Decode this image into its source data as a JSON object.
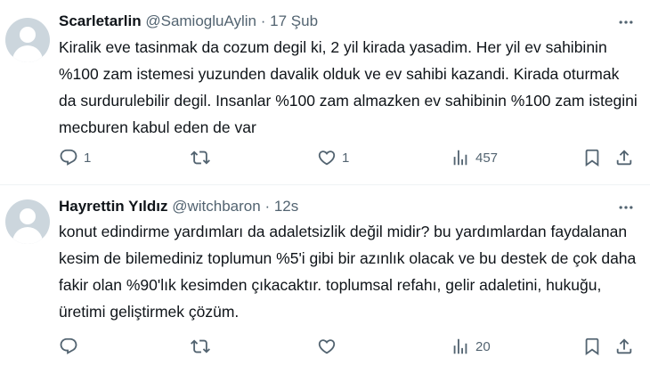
{
  "tweets": [
    {
      "author_name": "Scarletarlin",
      "handle": "@SamiogluAylin",
      "separator": "·",
      "time": "17 Şub",
      "text": "Kiralik eve tasinmak da cozum degil ki, 2 yil kirada yasadim. Her yil ev sahibinin %100 zam istemesi yuzunden davalik olduk ve ev sahibi kazandi. Kirada oturmak da surdurulebilir degil. Insanlar %100 zam almazken ev sahibinin %100 zam istegini mecburen kabul eden de var",
      "replies": "1",
      "retweets": "",
      "likes": "1",
      "views": "457"
    },
    {
      "author_name": "Hayrettin Yıldız",
      "handle": "@witchbaron",
      "separator": "·",
      "time": "12s",
      "text": "konut edindirme yardımları da adaletsizlik değil midir? bu yardımlardan faydalanan kesim de bilemediniz toplumun %5'i gibi bir azınlık olacak ve bu destek de çok daha fakir olan %90'lık kesimden çıkacaktır. toplumsal refahı, gelir adaletini, hukuğu, üretimi geliştirmek çözüm.",
      "replies": "",
      "retweets": "",
      "likes": "",
      "views": "20"
    }
  ],
  "icons": {
    "avatar": "default-avatar-icon",
    "more": "more-horizontal-icon",
    "reply": "reply-icon",
    "retweet": "retweet-icon",
    "like": "heart-icon",
    "views": "views-chart-icon",
    "bookmark": "bookmark-icon",
    "share": "share-icon"
  },
  "colors": {
    "text_primary": "#0f1419",
    "text_secondary": "#536471",
    "divider": "#eff3f4",
    "avatar_bg": "#ccd6dd"
  }
}
